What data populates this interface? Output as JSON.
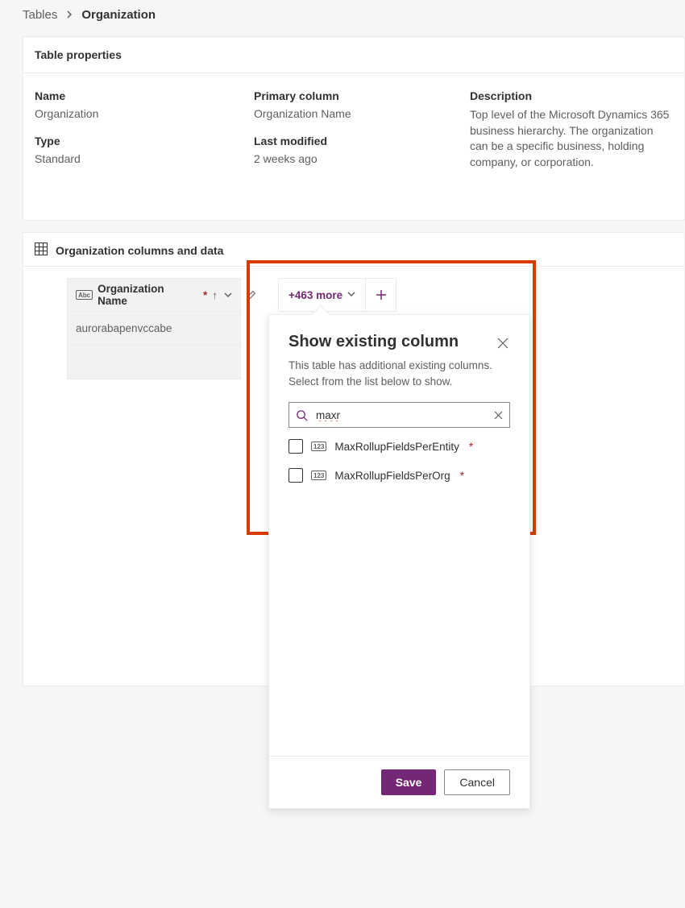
{
  "breadcrumb": {
    "parent": "Tables",
    "current": "Organization"
  },
  "properties_card": {
    "title": "Table properties",
    "labels": {
      "name": "Name",
      "type": "Type",
      "primary_column": "Primary column",
      "last_modified": "Last modified",
      "description": "Description"
    },
    "values": {
      "name": "Organization",
      "type": "Standard",
      "primary_column": "Organization Name",
      "last_modified": "2 weeks ago",
      "description": "Top level of the Microsoft Dynamics 365 business hierarchy. The organization can be a specific business, holding company, or corporation."
    }
  },
  "grid": {
    "title": "Organization columns and data",
    "column_header": {
      "type_badge": "Abc",
      "label": "Organization Name",
      "required_mark": "*",
      "sort_glyph": "↑"
    },
    "more_button": "+463 more",
    "rows": [
      {
        "org_name": "aurorabapenvccabe"
      }
    ]
  },
  "popover": {
    "title": "Show existing column",
    "subtitle": "This table has additional existing columns. Select from the list below to show.",
    "search_value": "maxr",
    "options": [
      {
        "type_badge": "123",
        "label": "MaxRollupFieldsPerEntity",
        "required": true
      },
      {
        "type_badge": "123",
        "label": "MaxRollupFieldsPerOrg",
        "required": true
      }
    ],
    "save_label": "Save",
    "cancel_label": "Cancel"
  },
  "highlight": {
    "color": "#d83b01"
  }
}
